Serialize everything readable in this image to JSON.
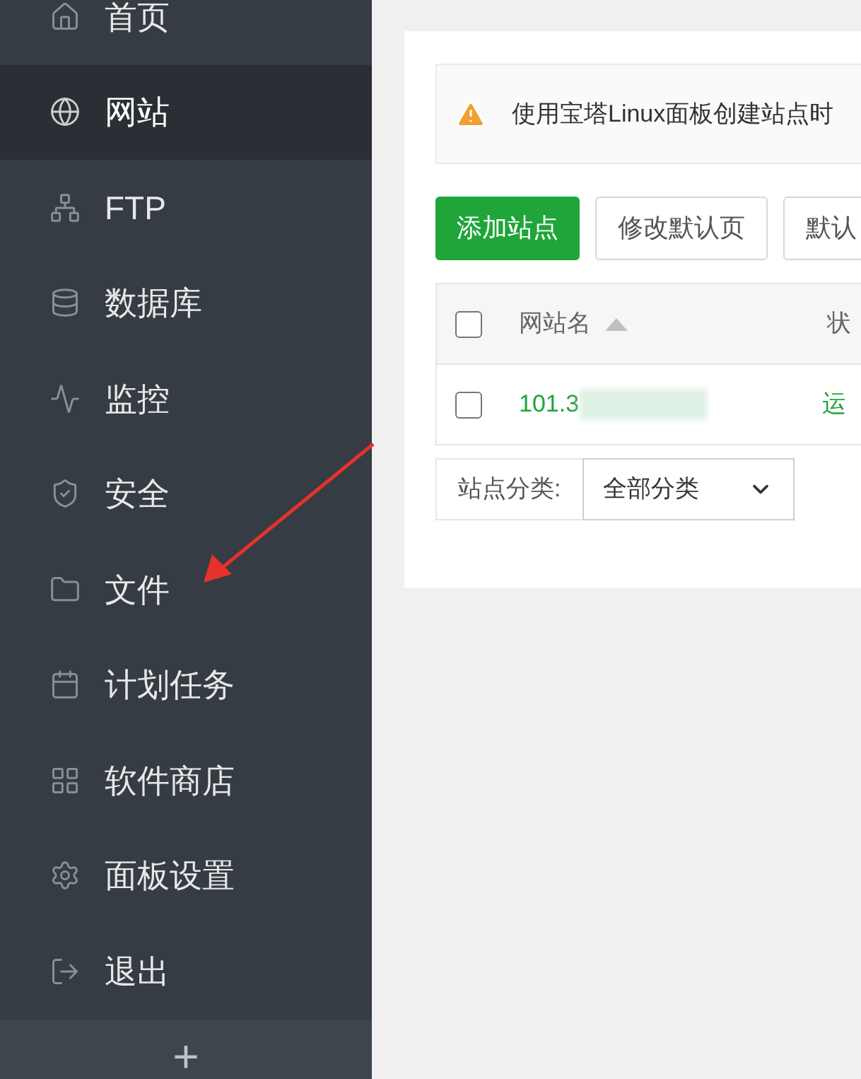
{
  "sidebar": {
    "items": [
      {
        "label": "首页",
        "selected": false
      },
      {
        "label": "网站",
        "selected": true
      },
      {
        "label": "FTP",
        "selected": false
      },
      {
        "label": "数据库",
        "selected": false
      },
      {
        "label": "监控",
        "selected": false
      },
      {
        "label": "安全",
        "selected": false
      },
      {
        "label": "文件",
        "selected": false
      },
      {
        "label": "计划任务",
        "selected": false
      },
      {
        "label": "软件商店",
        "selected": false
      },
      {
        "label": "面板设置",
        "selected": false
      },
      {
        "label": "退出",
        "selected": false
      }
    ],
    "add_button": "+"
  },
  "alert": {
    "text": "使用宝塔Linux面板创建站点时"
  },
  "toolbar": [
    {
      "label": "添加站点",
      "kind": "primary"
    },
    {
      "label": "修改默认页",
      "kind": "default"
    },
    {
      "label": "默认",
      "kind": "default"
    }
  ],
  "table": {
    "select_all_checked": false,
    "columns": [
      {
        "label": "网站名",
        "sorted": true
      },
      {
        "label": "状"
      }
    ],
    "rows": [
      {
        "checked": false,
        "name": "101.3",
        "status": "运"
      }
    ]
  },
  "filter": {
    "label": "站点分类:",
    "value": "全部分类"
  }
}
